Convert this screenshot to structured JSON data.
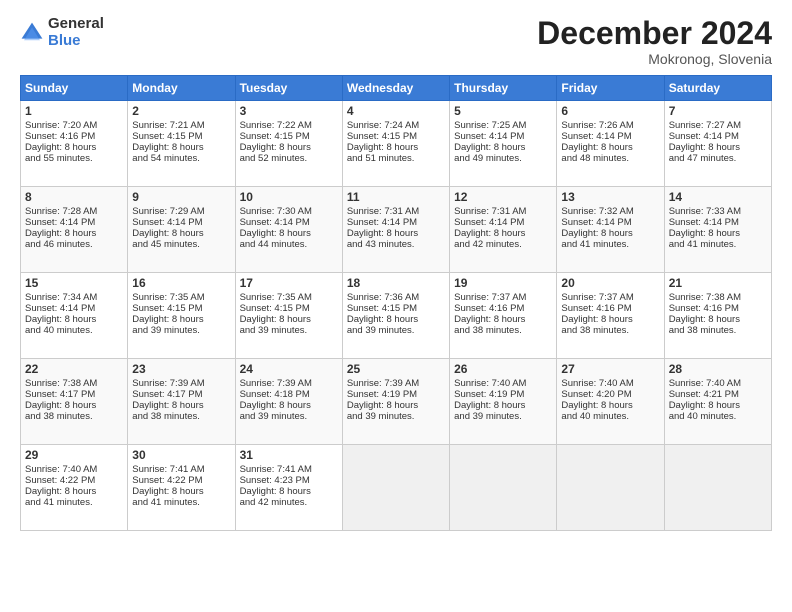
{
  "header": {
    "logo_general": "General",
    "logo_blue": "Blue",
    "month_title": "December 2024",
    "location": "Mokronog, Slovenia"
  },
  "days_of_week": [
    "Sunday",
    "Monday",
    "Tuesday",
    "Wednesday",
    "Thursday",
    "Friday",
    "Saturday"
  ],
  "weeks": [
    [
      {
        "day": 1,
        "lines": [
          "Sunrise: 7:20 AM",
          "Sunset: 4:16 PM",
          "Daylight: 8 hours",
          "and 55 minutes."
        ]
      },
      {
        "day": 2,
        "lines": [
          "Sunrise: 7:21 AM",
          "Sunset: 4:15 PM",
          "Daylight: 8 hours",
          "and 54 minutes."
        ]
      },
      {
        "day": 3,
        "lines": [
          "Sunrise: 7:22 AM",
          "Sunset: 4:15 PM",
          "Daylight: 8 hours",
          "and 52 minutes."
        ]
      },
      {
        "day": 4,
        "lines": [
          "Sunrise: 7:24 AM",
          "Sunset: 4:15 PM",
          "Daylight: 8 hours",
          "and 51 minutes."
        ]
      },
      {
        "day": 5,
        "lines": [
          "Sunrise: 7:25 AM",
          "Sunset: 4:14 PM",
          "Daylight: 8 hours",
          "and 49 minutes."
        ]
      },
      {
        "day": 6,
        "lines": [
          "Sunrise: 7:26 AM",
          "Sunset: 4:14 PM",
          "Daylight: 8 hours",
          "and 48 minutes."
        ]
      },
      {
        "day": 7,
        "lines": [
          "Sunrise: 7:27 AM",
          "Sunset: 4:14 PM",
          "Daylight: 8 hours",
          "and 47 minutes."
        ]
      }
    ],
    [
      {
        "day": 8,
        "lines": [
          "Sunrise: 7:28 AM",
          "Sunset: 4:14 PM",
          "Daylight: 8 hours",
          "and 46 minutes."
        ]
      },
      {
        "day": 9,
        "lines": [
          "Sunrise: 7:29 AM",
          "Sunset: 4:14 PM",
          "Daylight: 8 hours",
          "and 45 minutes."
        ]
      },
      {
        "day": 10,
        "lines": [
          "Sunrise: 7:30 AM",
          "Sunset: 4:14 PM",
          "Daylight: 8 hours",
          "and 44 minutes."
        ]
      },
      {
        "day": 11,
        "lines": [
          "Sunrise: 7:31 AM",
          "Sunset: 4:14 PM",
          "Daylight: 8 hours",
          "and 43 minutes."
        ]
      },
      {
        "day": 12,
        "lines": [
          "Sunrise: 7:31 AM",
          "Sunset: 4:14 PM",
          "Daylight: 8 hours",
          "and 42 minutes."
        ]
      },
      {
        "day": 13,
        "lines": [
          "Sunrise: 7:32 AM",
          "Sunset: 4:14 PM",
          "Daylight: 8 hours",
          "and 41 minutes."
        ]
      },
      {
        "day": 14,
        "lines": [
          "Sunrise: 7:33 AM",
          "Sunset: 4:14 PM",
          "Daylight: 8 hours",
          "and 41 minutes."
        ]
      }
    ],
    [
      {
        "day": 15,
        "lines": [
          "Sunrise: 7:34 AM",
          "Sunset: 4:14 PM",
          "Daylight: 8 hours",
          "and 40 minutes."
        ]
      },
      {
        "day": 16,
        "lines": [
          "Sunrise: 7:35 AM",
          "Sunset: 4:15 PM",
          "Daylight: 8 hours",
          "and 39 minutes."
        ]
      },
      {
        "day": 17,
        "lines": [
          "Sunrise: 7:35 AM",
          "Sunset: 4:15 PM",
          "Daylight: 8 hours",
          "and 39 minutes."
        ]
      },
      {
        "day": 18,
        "lines": [
          "Sunrise: 7:36 AM",
          "Sunset: 4:15 PM",
          "Daylight: 8 hours",
          "and 39 minutes."
        ]
      },
      {
        "day": 19,
        "lines": [
          "Sunrise: 7:37 AM",
          "Sunset: 4:16 PM",
          "Daylight: 8 hours",
          "and 38 minutes."
        ]
      },
      {
        "day": 20,
        "lines": [
          "Sunrise: 7:37 AM",
          "Sunset: 4:16 PM",
          "Daylight: 8 hours",
          "and 38 minutes."
        ]
      },
      {
        "day": 21,
        "lines": [
          "Sunrise: 7:38 AM",
          "Sunset: 4:16 PM",
          "Daylight: 8 hours",
          "and 38 minutes."
        ]
      }
    ],
    [
      {
        "day": 22,
        "lines": [
          "Sunrise: 7:38 AM",
          "Sunset: 4:17 PM",
          "Daylight: 8 hours",
          "and 38 minutes."
        ]
      },
      {
        "day": 23,
        "lines": [
          "Sunrise: 7:39 AM",
          "Sunset: 4:17 PM",
          "Daylight: 8 hours",
          "and 38 minutes."
        ]
      },
      {
        "day": 24,
        "lines": [
          "Sunrise: 7:39 AM",
          "Sunset: 4:18 PM",
          "Daylight: 8 hours",
          "and 39 minutes."
        ]
      },
      {
        "day": 25,
        "lines": [
          "Sunrise: 7:39 AM",
          "Sunset: 4:19 PM",
          "Daylight: 8 hours",
          "and 39 minutes."
        ]
      },
      {
        "day": 26,
        "lines": [
          "Sunrise: 7:40 AM",
          "Sunset: 4:19 PM",
          "Daylight: 8 hours",
          "and 39 minutes."
        ]
      },
      {
        "day": 27,
        "lines": [
          "Sunrise: 7:40 AM",
          "Sunset: 4:20 PM",
          "Daylight: 8 hours",
          "and 40 minutes."
        ]
      },
      {
        "day": 28,
        "lines": [
          "Sunrise: 7:40 AM",
          "Sunset: 4:21 PM",
          "Daylight: 8 hours",
          "and 40 minutes."
        ]
      }
    ],
    [
      {
        "day": 29,
        "lines": [
          "Sunrise: 7:40 AM",
          "Sunset: 4:22 PM",
          "Daylight: 8 hours",
          "and 41 minutes."
        ]
      },
      {
        "day": 30,
        "lines": [
          "Sunrise: 7:41 AM",
          "Sunset: 4:22 PM",
          "Daylight: 8 hours",
          "and 41 minutes."
        ]
      },
      {
        "day": 31,
        "lines": [
          "Sunrise: 7:41 AM",
          "Sunset: 4:23 PM",
          "Daylight: 8 hours",
          "and 42 minutes."
        ]
      },
      null,
      null,
      null,
      null
    ]
  ]
}
